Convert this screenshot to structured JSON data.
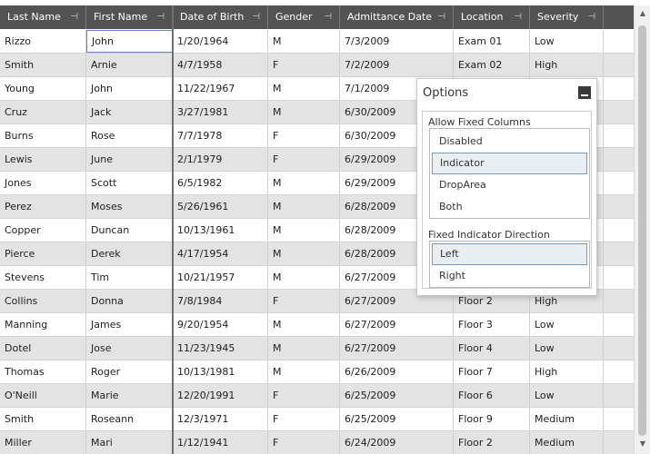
{
  "columns": [
    {
      "label": "Last Name",
      "pinned": true
    },
    {
      "label": "First Name",
      "pinned": true
    },
    {
      "label": "Date of Birth",
      "pinned": true
    },
    {
      "label": "Gender",
      "pinned": true
    },
    {
      "label": "Admittance Date",
      "pinned": true
    },
    {
      "label": "Location",
      "pinned": true
    },
    {
      "label": "Severity",
      "pinned": true
    }
  ],
  "pin_glyph": "⊣",
  "rows": [
    [
      "Rizzo",
      "John",
      "1/20/1964",
      "M",
      "7/3/2009",
      "Exam 01",
      "Low"
    ],
    [
      "Smith",
      "Arnie",
      "4/7/1958",
      "F",
      "7/2/2009",
      "Exam 02",
      "High"
    ],
    [
      "Young",
      "John",
      "11/22/1967",
      "M",
      "7/1/2009",
      "",
      ""
    ],
    [
      "Cruz",
      "Jack",
      "3/27/1981",
      "M",
      "6/30/2009",
      "",
      ""
    ],
    [
      "Burns",
      "Rose",
      "7/7/1978",
      "F",
      "6/30/2009",
      "",
      ""
    ],
    [
      "Lewis",
      "June",
      "2/1/1979",
      "F",
      "6/29/2009",
      "",
      ""
    ],
    [
      "Jones",
      "Scott",
      "6/5/1982",
      "M",
      "6/29/2009",
      "",
      ""
    ],
    [
      "Perez",
      "Moses",
      "5/26/1961",
      "M",
      "6/28/2009",
      "",
      ""
    ],
    [
      "Copper",
      "Duncan",
      "10/13/1961",
      "M",
      "6/28/2009",
      "",
      ""
    ],
    [
      "Pierce",
      "Derek",
      "4/17/1954",
      "M",
      "6/28/2009",
      "",
      ""
    ],
    [
      "Stevens",
      "Tim",
      "10/21/1957",
      "M",
      "6/27/2009",
      "",
      ""
    ],
    [
      "Collins",
      "Donna",
      "7/8/1984",
      "F",
      "6/27/2009",
      "Floor 2",
      "High"
    ],
    [
      "Manning",
      "James",
      "9/20/1954",
      "M",
      "6/27/2009",
      "Floor 3",
      "Low"
    ],
    [
      "Dotel",
      "Jose",
      "11/23/1945",
      "M",
      "6/27/2009",
      "Floor 4",
      "Low"
    ],
    [
      "Thomas",
      "Roger",
      "10/13/1981",
      "M",
      "6/26/2009",
      "Floor 7",
      "High"
    ],
    [
      "O'Neill",
      "Marie",
      "12/20/1991",
      "F",
      "6/25/2009",
      "Floor 6",
      "Low"
    ],
    [
      "Smith",
      "Roseann",
      "12/3/1971",
      "F",
      "6/25/2009",
      "Floor 9",
      "Medium"
    ],
    [
      "Miller",
      "Mari",
      "1/12/1941",
      "F",
      "6/24/2009",
      "Floor 2",
      "Medium"
    ]
  ],
  "focused_cell": {
    "row": 0,
    "col": 1
  },
  "options_panel": {
    "title": "Options",
    "allow_fixed_label": "Allow Fixed Columns",
    "allow_fixed_options": [
      "Disabled",
      "Indicator",
      "DropArea",
      "Both"
    ],
    "allow_fixed_selected": "Indicator",
    "direction_label": "Fixed Indicator Direction",
    "direction_options": [
      "Left",
      "Right"
    ],
    "direction_selected": "Left"
  },
  "colors": {
    "header_bg": "#535353",
    "alt_row_bg": "#e3e3e3",
    "selection_border": "#6f9cc4"
  }
}
